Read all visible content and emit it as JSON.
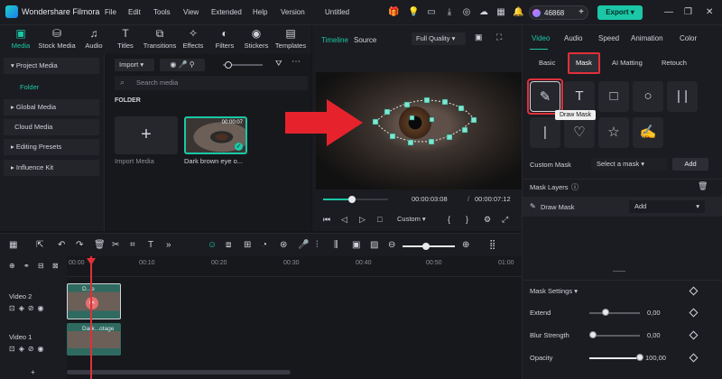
{
  "app": {
    "name": "Wondershare Filmora",
    "project": "Untitled"
  },
  "menu": [
    "File",
    "Edit",
    "Tools",
    "View",
    "Extended",
    "Help",
    "Version"
  ],
  "header": {
    "points": "46868",
    "export_label": "Export"
  },
  "media_tabs": [
    {
      "label": "Media",
      "icon": "media-icon"
    },
    {
      "label": "Stock Media",
      "icon": "stock-media-icon"
    },
    {
      "label": "Audio",
      "icon": "audio-icon"
    },
    {
      "label": "Titles",
      "icon": "titles-icon"
    },
    {
      "label": "Transitions",
      "icon": "transitions-icon"
    },
    {
      "label": "Effects",
      "icon": "effects-icon"
    },
    {
      "label": "Filters",
      "icon": "filters-icon"
    },
    {
      "label": "Stickers",
      "icon": "stickers-icon"
    },
    {
      "label": "Templates",
      "icon": "templates-icon"
    }
  ],
  "sidebar": {
    "items": [
      "Project Media",
      "Folder",
      "Global Media",
      "Cloud Media",
      "Editing Presets",
      "Influence Kit"
    ]
  },
  "media": {
    "import_label": "Import",
    "search_placeholder": "Search media",
    "folder_label": "FOLDER",
    "import_tile_label": "Import Media",
    "clip_label": "Dark brown eye o...",
    "clip_duration": "00:00:07"
  },
  "player": {
    "tab_timeline": "Timeline",
    "tab_source": "Source",
    "quality": "Full Quality",
    "current_time": "00:00:03:08",
    "total_time": "00:00:07:12",
    "scrub_fraction": 0.45,
    "zoom_label": "Custom"
  },
  "right": {
    "tabs": [
      "Video",
      "Audio",
      "Speed",
      "Animation",
      "Color"
    ],
    "subtabs": [
      "Basic",
      "Mask",
      "AI Matting",
      "Retouch"
    ],
    "tooltip": "Draw Mask",
    "custom_mask_label": "Custom Mask",
    "select_mask": "Select a mask",
    "add_label": "Add",
    "mask_layers_label": "Mask Layers",
    "layer_name": "Draw Mask",
    "layer_action": "Add",
    "mask_settings_label": "Mask Settings",
    "extend": {
      "label": "Extend",
      "value": "0,00"
    },
    "blur": {
      "label": "Blur Strength",
      "value": "0,00"
    },
    "opacity": {
      "label": "Opacity",
      "value": "100,00"
    }
  },
  "timeline": {
    "ruler": [
      "00:00",
      "00:10",
      "00:20",
      "00:30",
      "00:40",
      "00:50",
      "01:00"
    ],
    "tracks": [
      {
        "label": "Video 2",
        "clip": "D...e"
      },
      {
        "label": "Video 1",
        "clip": "Dark...otage"
      }
    ]
  },
  "colors": {
    "accent": "#1bc7a6",
    "highlight": "#e0303a"
  }
}
